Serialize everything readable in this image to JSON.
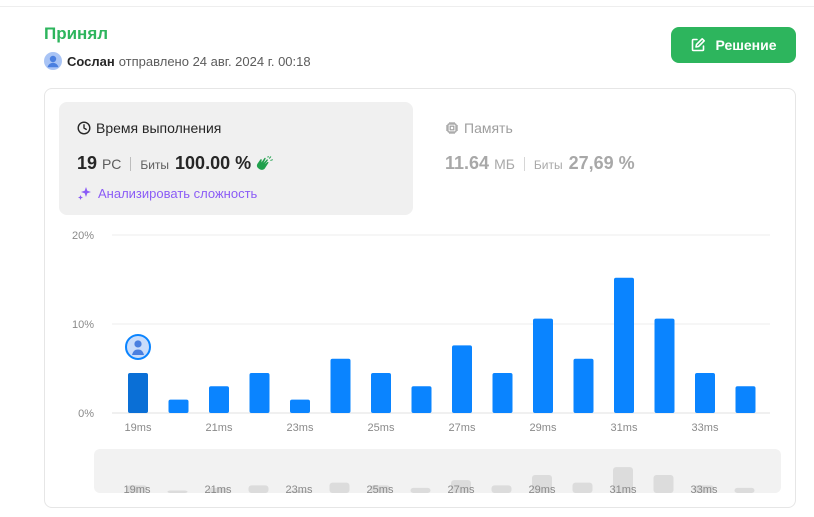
{
  "submission": {
    "status": "Принял",
    "user": "Сослан",
    "submitted_text": "отправлено 24 авг. 2024 г. 00:18",
    "solution_button": "Решение"
  },
  "runtime": {
    "title": "Время выполнения",
    "value": "19",
    "unit": "РС",
    "beats_label": "Биты",
    "beats_value": "100.00 %",
    "analyze_label": "Анализировать сложность"
  },
  "memory": {
    "title": "Память",
    "value": "11.64",
    "unit": "МБ",
    "beats_label": "Биты",
    "beats_value": "27,69 %"
  },
  "colors": {
    "accepted": "#2db55d",
    "bar": "#0a84ff",
    "bar_selected": "#0a6fd6",
    "analyze": "#8b5cf6"
  },
  "chart_data": {
    "type": "bar",
    "categories": [
      "19ms",
      "20ms",
      "21ms",
      "22ms",
      "23ms",
      "24ms",
      "25ms",
      "26ms",
      "27ms",
      "28ms",
      "29ms",
      "30ms",
      "31ms",
      "32ms",
      "33ms",
      "34ms"
    ],
    "x_tick_labels": [
      "19ms",
      "21ms",
      "23ms",
      "25ms",
      "27ms",
      "29ms",
      "31ms",
      "33ms"
    ],
    "values": [
      4.5,
      1.5,
      3.0,
      4.5,
      1.5,
      6.1,
      4.5,
      3.0,
      7.6,
      4.5,
      10.6,
      6.1,
      15.2,
      10.6,
      4.5,
      3.0
    ],
    "y_ticks": [
      "0%",
      "10%",
      "20%"
    ],
    "ylim": [
      0,
      20
    ],
    "selected_category": "19ms",
    "grid": true
  }
}
